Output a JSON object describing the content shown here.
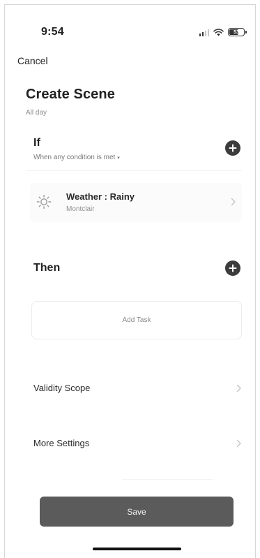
{
  "status_bar": {
    "time": "9:54",
    "battery_level": "53"
  },
  "nav": {
    "cancel_label": "Cancel"
  },
  "header": {
    "title": "Create Scene",
    "subtitle": "All day"
  },
  "if_section": {
    "heading": "If",
    "condition_mode": "When any condition is met",
    "conditions": [
      {
        "title": "Weather : Rainy",
        "subtitle": "Montclair",
        "icon": "sun-icon"
      }
    ]
  },
  "then_section": {
    "heading": "Then",
    "add_task_label": "Add Task"
  },
  "settings": {
    "validity_scope_label": "Validity Scope",
    "more_settings_label": "More Settings"
  },
  "footer": {
    "save_label": "Save"
  },
  "colors": {
    "save_button": "#5b5b5b",
    "add_button": "#3c3c3c",
    "muted_text": "#8a8a8a"
  }
}
